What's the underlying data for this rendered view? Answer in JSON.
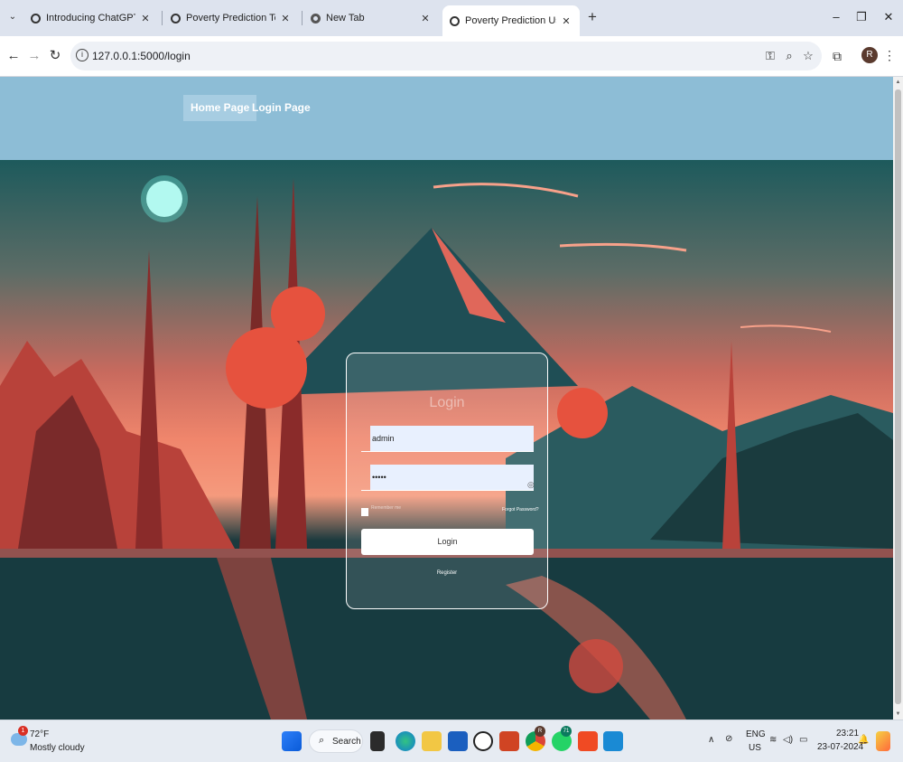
{
  "browser": {
    "tabs": [
      {
        "title": "Introducing ChatGPT | OpenAI",
        "active": false
      },
      {
        "title": "Poverty Prediction Techniques",
        "active": false
      },
      {
        "title": "New Tab",
        "active": false
      },
      {
        "title": "Poverty Prediction Using Machi",
        "active": true
      }
    ],
    "url": "127.0.0.1:5000/login"
  },
  "site": {
    "nav": [
      "Home Page",
      "Login Page"
    ]
  },
  "login": {
    "title": "Login",
    "username_value": "admin",
    "password_value": "•••••",
    "remember_label": "Remember me",
    "forgot_label": "Forgot Password?",
    "button_label": "Login",
    "register_label": "Register"
  },
  "taskbar": {
    "weather_temp": "72°F",
    "weather_desc": "Mostly cloudy",
    "weather_badge": "1",
    "search_label": "Search",
    "lang_top": "ENG",
    "lang_bottom": "US",
    "time": "23:21",
    "date": "23-07-2024",
    "chrome_badge": "R",
    "whatsapp_badge": "71"
  }
}
